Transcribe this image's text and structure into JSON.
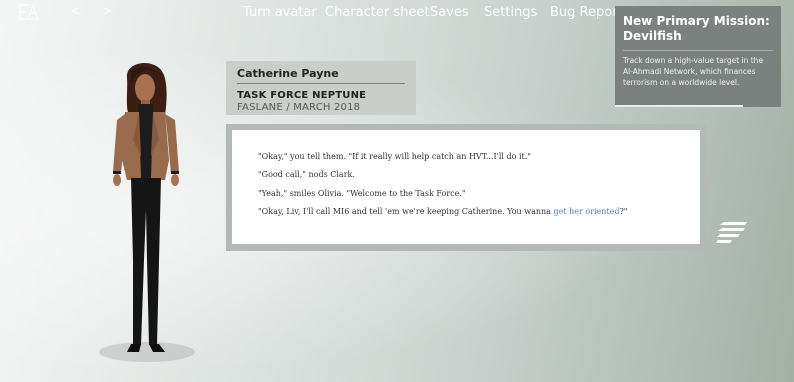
{
  "topbar": {
    "logo": "game-logo",
    "back_label": "<",
    "forward_label": ">",
    "turn_avatar": "Turn avatar",
    "character_sheet": "Character sheet",
    "saves": "Saves",
    "settings": "Settings",
    "bug_report": "Bug Report"
  },
  "character": {
    "name": "Catherine Payne",
    "unit": "TASK FORCE NEPTUNE",
    "location": "FASLANE / MARCH 2018"
  },
  "dialogue": {
    "line1": "\"Okay,\" you tell them. \"If it really will help catch an HVT...I'll do it.\"",
    "line2": "\"Good call,\" nods Clark.",
    "line3": "\"Yeah,\" smiles Olivia. \"Welcome to the Task Force.\"",
    "line4_before": "\"Okay, Liv, I'll call MI6 and tell 'em we're keeping Catherine. You wanna ",
    "line4_link": "get her oriented",
    "line4_after": "?\""
  },
  "mission": {
    "title": "New Primary Mission: Devilfish",
    "text": "Track down a high-value target in the Al-Ahmadi Network, which finances terrorism on a worldwide level.",
    "progress": 0.77
  },
  "icons": {
    "menu": "menu-lines-icon"
  }
}
